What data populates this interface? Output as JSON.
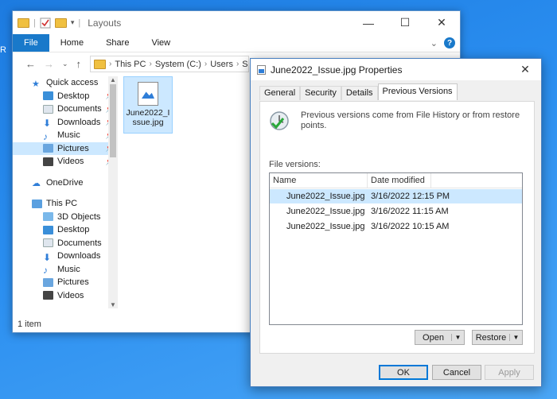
{
  "desktop": {
    "edge_text": "R"
  },
  "explorer": {
    "title": "Layouts",
    "window_controls": [
      "—",
      "☐",
      "✕"
    ],
    "ribbon": {
      "file": "File",
      "home": "Home",
      "share": "Share",
      "view": "View"
    },
    "address": {
      "segments": [
        "This PC",
        "System (C:)",
        "Users",
        "S"
      ]
    },
    "nav_pane": {
      "quick_access": "Quick access",
      "quick_items": [
        "Desktop",
        "Documents",
        "Downloads",
        "Music",
        "Pictures",
        "Videos"
      ],
      "onedrive": "OneDrive",
      "this_pc": "This PC",
      "pc_items": [
        "3D Objects",
        "Desktop",
        "Documents",
        "Downloads",
        "Music",
        "Pictures",
        "Videos"
      ]
    },
    "file": {
      "name": "June2022_Issue.jpg"
    },
    "status": "1 item"
  },
  "props": {
    "title": "June2022_Issue.jpg Properties",
    "tabs": [
      "General",
      "Security",
      "Details",
      "Previous Versions"
    ],
    "description": "Previous versions come from File History or from restore points.",
    "file_versions_label": "File versions:",
    "columns": [
      "Name",
      "Date modified"
    ],
    "versions": [
      {
        "name": "June2022_Issue.jpg",
        "date": "3/16/2022 12:15 PM"
      },
      {
        "name": "June2022_Issue.jpg",
        "date": "3/16/2022 11:15 AM"
      },
      {
        "name": "June2022_Issue.jpg",
        "date": "3/16/2022 10:15 AM"
      }
    ],
    "open_label": "Open",
    "restore_label": "Restore",
    "ok_label": "OK",
    "cancel_label": "Cancel",
    "apply_label": "Apply"
  },
  "colors": {
    "accent": "#0078d7",
    "selection": "#cce8ff",
    "file_tab": "#1979ca"
  }
}
